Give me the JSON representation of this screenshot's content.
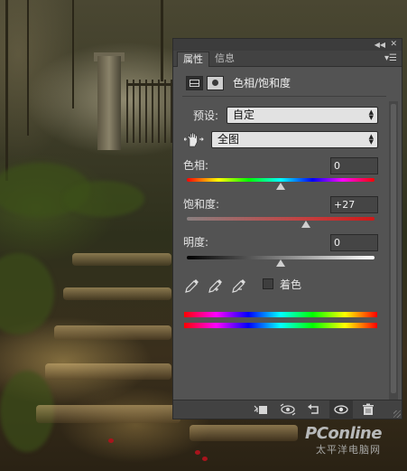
{
  "panel": {
    "tabs": [
      {
        "label": "属性",
        "active": true
      },
      {
        "label": "信息",
        "active": false
      }
    ],
    "header_title": "色相/饱和度",
    "preset": {
      "label": "预设:",
      "value": "自定"
    },
    "range": {
      "value": "全图"
    },
    "hue": {
      "label": "色相:",
      "value": "0",
      "level": 0
    },
    "saturation": {
      "label": "饱和度:",
      "value": "+27",
      "level": 27
    },
    "lightness": {
      "label": "明度:",
      "value": "0",
      "level": 0
    },
    "colorize": {
      "label": "着色",
      "checked": false
    },
    "icons": [
      "adjustment-layer-icon",
      "mask-icon",
      "targeted-adjust-hand-icon",
      "eyedropper-icon",
      "eyedropper-plus-icon",
      "eyedropper-minus-icon",
      "clip-to-layer-icon",
      "view-previous-icon",
      "reset-icon",
      "visibility-eye-icon",
      "trash-icon"
    ]
  },
  "watermark": {
    "brand": "PConline",
    "sub": "太平洋电脑网"
  },
  "colors": {
    "panel_bg": "#535353",
    "tabbar_bg": "#424242",
    "input_bg": "#e2e2e2"
  }
}
